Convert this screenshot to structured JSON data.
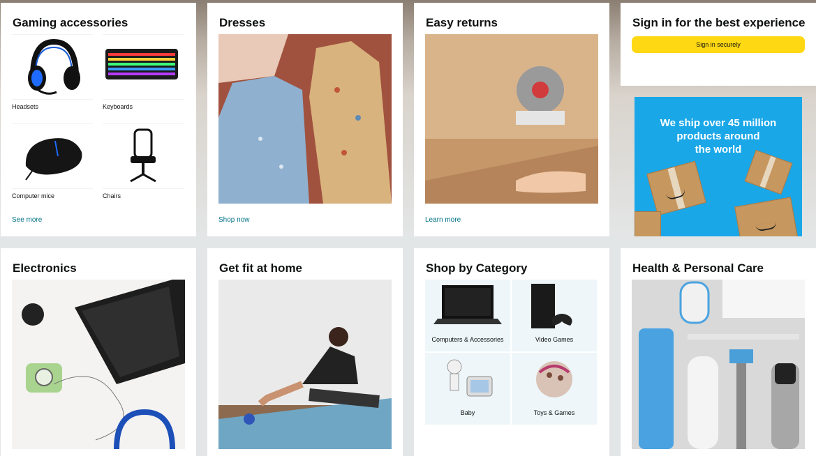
{
  "gaming": {
    "title": "Gaming accessories",
    "items": [
      {
        "label": "Headsets"
      },
      {
        "label": "Keyboards"
      },
      {
        "label": "Computer mice"
      },
      {
        "label": "Chairs"
      }
    ],
    "link": "See more"
  },
  "dresses": {
    "title": "Dresses",
    "link": "Shop now"
  },
  "returns": {
    "title": "Easy returns",
    "link": "Learn more"
  },
  "signin": {
    "title": "Sign in for the best experience",
    "button": "Sign in securely"
  },
  "shipping_banner": {
    "line1": "We ship over 45 million",
    "line2": "products around",
    "line3": "the world"
  },
  "electronics": {
    "title": "Electronics"
  },
  "fitness": {
    "title": "Get fit at home"
  },
  "category": {
    "title": "Shop by Category",
    "items": [
      {
        "label": "Computers & Accessories"
      },
      {
        "label": "Video Games"
      },
      {
        "label": "Baby"
      },
      {
        "label": "Toys & Games"
      }
    ]
  },
  "health": {
    "title": "Health & Personal Care"
  },
  "colors": {
    "accent": "#ffd814",
    "link": "#007185",
    "banner": "#1aa7e8"
  }
}
